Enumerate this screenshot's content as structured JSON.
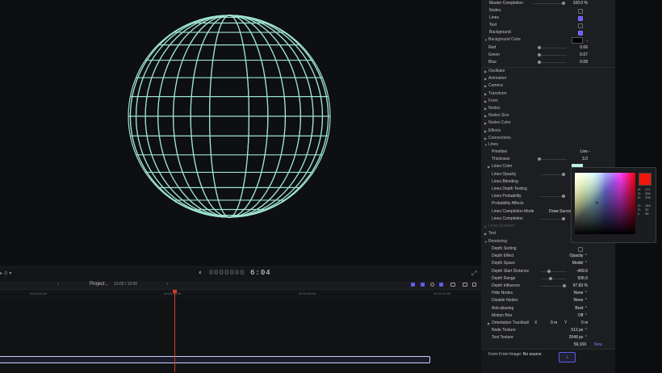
{
  "viewer": {
    "timecode_dim": "0000000",
    "timecode": "6:04"
  },
  "timeline": {
    "project_label": "Project",
    "duration": "10:00 / 10:00",
    "ruler_marks": [
      "00:00:04:00",
      "00:00:06:00",
      "00:00:08:00",
      "00:00:10:00"
    ]
  },
  "inspector": {
    "top": [
      {
        "label": "Master Completion",
        "value": "100.0 %",
        "type": "slider",
        "knob": 1.0
      },
      {
        "label": "Nodes",
        "type": "checkbox",
        "checked": false
      },
      {
        "label": "Lines",
        "type": "checkbox",
        "checked": true
      },
      {
        "label": "Text",
        "type": "checkbox",
        "checked": false
      },
      {
        "label": "Background",
        "type": "checkbox",
        "checked": true
      }
    ],
    "background_color": {
      "label": "Background Color",
      "swatch": "#000000",
      "channels": [
        {
          "label": "Red",
          "value": "0.06"
        },
        {
          "label": "Green",
          "value": "0.07"
        },
        {
          "label": "Blue",
          "value": "0.08"
        }
      ]
    },
    "sections": [
      "Oscillator",
      "Animation",
      "Camera",
      "Transform",
      "Form",
      "Nodes",
      "Nodes Size",
      "Nodes Color",
      "Effects",
      "Connections"
    ],
    "lines": {
      "label": "Lines",
      "primitive_label": "Primitive",
      "primitive_value": "Line",
      "thickness_label": "Thickness",
      "thickness_value": "3.0",
      "color_label": "Lines Color",
      "color_swatch": "#b9f3de",
      "opacity_label": "Lines Opacity",
      "blending_label": "Lines Blending",
      "depth_testing_label": "Lines Depth Testing",
      "probability_label": "Lines Probability",
      "prob_affects_label": "Probability Affects",
      "completion_mode_label": "Lines Completion Mode",
      "completion_mode_value": "Draw Succe",
      "completion_label": "Lines Completion"
    },
    "hidden_section": "Lines Gradient",
    "text_section": "Text",
    "rendering": {
      "label": "Rendering",
      "rows": [
        {
          "label": "Depth Sorting",
          "type": "checkbox",
          "checked": false
        },
        {
          "label": "Depth Effect",
          "value": "Opacity ⌃",
          "type": "popup"
        },
        {
          "label": "Depth Space",
          "value": "Model ⌃",
          "type": "popup"
        },
        {
          "label": "Depth Start Distance",
          "value": "-469.6",
          "type": "slider",
          "knob": 0.3
        },
        {
          "label": "Depth Range",
          "value": "506.6",
          "type": "slider",
          "knob": 0.35
        },
        {
          "label": "Depth Influence",
          "value": "97.83 %",
          "type": "slider",
          "knob": 0.95
        },
        {
          "label": "Hide Nodes",
          "value": "None ⌃",
          "type": "popup"
        },
        {
          "label": "Disable Nodes",
          "value": "None ⌃",
          "type": "popup"
        },
        {
          "label": "Anti-aliasing",
          "value": "Best ⌃",
          "type": "popup"
        },
        {
          "label": "Motion Blur",
          "value": "Off ⌃",
          "type": "popup"
        }
      ],
      "trackball_label": "Orientation Trackball",
      "trackball_x_label": "X",
      "trackball_x": "0 m",
      "trackball_y_label": "Y",
      "trackball_y": "0 m",
      "node_texture_label": "Node Texture",
      "node_texture_value": "512 px ⌃",
      "text_texture_label": "Text Texture",
      "text_texture_value": "2048 px ⌃",
      "count_value": "59,169",
      "new_label": "New"
    },
    "footer": {
      "form_label": "Form From Image:",
      "form_value": "No source",
      "import_icon": "arrow-down-icon"
    }
  },
  "color_picker": {
    "current": "#f0170c",
    "rows": [
      {
        "k": "R:",
        "v": "171"
      },
      {
        "k": "G:",
        "v": "250"
      },
      {
        "k": "B:",
        "v": "230"
      },
      {
        "k": "",
        "v": ""
      },
      {
        "k": "H:",
        "v": "164"
      },
      {
        "k": "S:",
        "v": "32"
      },
      {
        "k": "L:",
        "v": "98"
      }
    ]
  },
  "colors": {
    "sphere": "#9fe3cf",
    "playhead": "#d83a2a",
    "accent": "#6a5cff"
  }
}
